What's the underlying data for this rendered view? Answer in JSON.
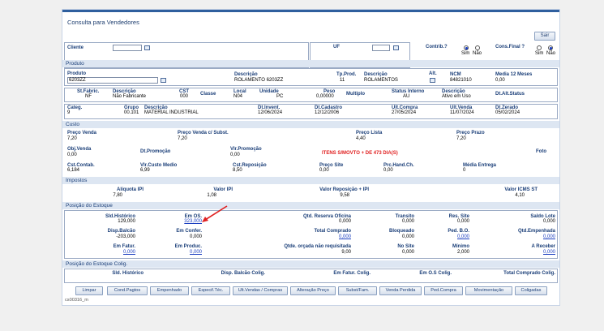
{
  "window": {
    "title": "Consulta para Vendedores",
    "footer_code": "cs00316_m"
  },
  "toolbar": {
    "sair_label": "Sair"
  },
  "filters": {
    "cliente_label": "Cliente",
    "cliente_value": "",
    "uf_label": "UF",
    "uf_value": "",
    "contrib_label": "Contrib.?",
    "final_label": "Cons.Final ?",
    "sim_label": "Sim",
    "nao_label": "Não"
  },
  "sections": {
    "produto": "Produto",
    "custo": "Custo",
    "impostos": "Impostos",
    "estoque": "Posição do Estoque",
    "estoque_colig": "Posição do Estoque Colig."
  },
  "produto": {
    "produto_label": "Produto",
    "produto_value": "6203ZZ",
    "descricao_label": "Descrição",
    "descricao_value": "ROLAMENTO 6203ZZ",
    "tpprod_label": "Tp.Prod.",
    "tpprod_value": "11",
    "desc2_label": "Descrição",
    "desc2_value": "ROLAMENTOS",
    "alt_label": "Alt.",
    "ncm_label": "NCM",
    "ncm_value": "84821010",
    "media_label": "Media 12 Meses",
    "media_value": "0,00",
    "stfabric_label": "St.Fabric.",
    "stfabric_value": "NF",
    "desc3_label": "Descrição",
    "desc3_value": "Não Fabricante",
    "cst_label": "CST",
    "cst_value": "000",
    "classe_label": "Classe",
    "local_label": "Local",
    "local_value": "N04",
    "unidade_label": "Unidade",
    "unidade_value": "PC",
    "peso_label": "Peso",
    "peso_value": "0,00000",
    "multiplo_label": "Multiplo",
    "status_label": "Status Interno",
    "status_value": "AU",
    "desc4_label": "Descrição",
    "desc4_value": "Ativo em Uso",
    "dtalt_label": "Dt.Alt.Status",
    "categ_label": "Categ.",
    "categ_value": "9",
    "grupo_label": "Grupo",
    "grupo_value": "00.101",
    "desc5_label": "Descrição",
    "desc5_value": "MATERIAL INDUSTRIAL",
    "dtinvent_label": "Dt.Invent.",
    "dtinvent_value": "12/06/2024",
    "dtcadastro_label": "Dt.Cadastro",
    "dtcadastro_value": "12/12/2006",
    "ultcompra_label": "Ult.Compra",
    "ultcompra_value": "27/05/2024",
    "ultvenda_label": "Ult.Venda",
    "ultvenda_value": "11/07/2024",
    "dtzerado_label": "Dt.Zerado",
    "dtzerado_value": "05/02/2024"
  },
  "custo": {
    "precovenda_label": "Preço Venda",
    "precovenda_value": "7,20",
    "precovendasubst_label": "Preço Venda c/ Subst.",
    "precovendasubst_value": "7,20",
    "precolista_label": "Preço Lista",
    "precolista_value": "4,40",
    "precoprazo_label": "Preço Prazo",
    "precoprazo_value": "7,20",
    "objvenda_label": "Obj.Venda",
    "objvenda_value": "0,00",
    "dtpromocao_label": "Dt.Promoção",
    "vlrpromocao_label": "Vlr.Promoção",
    "vlrpromocao_value": "0,00",
    "alert": "ITENS S/MOVTO + DE 473 DIA(S)",
    "foto_label": "Foto",
    "cstcontab_label": "Cst.Contab.",
    "cstcontab_value": "6,184",
    "vlrcusto_label": "Vlr.Custo Medio",
    "vlrcusto_value": "6,99",
    "cstrepos_label": "Cst.Reposição",
    "cstrepos_value": "8,50",
    "precosite_label": "Preço Site",
    "precosite_value": "0,00",
    "prchand_label": "Prc.Hand.Ch.",
    "prchand_value": "0,00",
    "mediaentrega_label": "Média Entrega",
    "mediaentrega_value": "0"
  },
  "impostos": {
    "aliqipi_label": "Alíquota IPI",
    "aliqipi_value": "7,80",
    "valoripi_label": "Valor IPI",
    "valoripi_value": "1,08",
    "valorrepos_label": "Valor Reposição + IPI",
    "valorrepos_value": "9,58",
    "valoricms_label": "Valor ICMS ST",
    "valoricms_value": "4,10"
  },
  "estoque": {
    "sldhist_label": "Sld.Histórico",
    "sldhist_value": "129,000",
    "emos_label": "Em OS.",
    "emos_value": "323,000",
    "qtdreserva_label": "Qtd. Reserva Oficina",
    "qtdreserva_value": "0,000",
    "transito_label": "Transito",
    "transito_value": "0,000",
    "ressite_label": "Res. Site",
    "ressite_value": "0,000",
    "saldolote_label": "Saldo Lote",
    "saldolote_value": "0,000",
    "dispbalcao_label": "Disp.Balcão",
    "dispbalcao_value": "-203,000",
    "emconfer_label": "Em Confer.",
    "emconfer_value": "0,000",
    "totalcomprado_label": "Total Comprado",
    "totalcomprado_value": "0,000",
    "bloqueado_label": "Bloqueado",
    "bloqueado_value": "0,000",
    "pedbo_label": "Ped. B.O.",
    "pedbo_value": "0,000",
    "qtdempenhada_label": "Qtd.Empenhada",
    "qtdempenhada_value": "0,000",
    "emfatur_label": "Em Fatur.",
    "emfatur_value": "0,000",
    "emproduc_label": "Em Produc.",
    "emproduc_value": "0,000",
    "qtdeorcada_label": "Qtde. orçada não requisitada",
    "qtdeorcada_value": "9,00",
    "nosite_label": "No Site",
    "nosite_value": "0,000",
    "minimo_label": "Mínimo",
    "minimo_value": "2,000",
    "areceber_label": "A Receber",
    "areceber_value": "0,000"
  },
  "estoque_colig": {
    "sldhist_label": "Sld. Histórico",
    "dispbalcao_label": "Disp. Balcão Colig.",
    "emfatur_label": "Em Fatur. Colig.",
    "emos_label": "Em O.S Colig.",
    "totalcomprado_label": "Total Comprado Colig."
  },
  "buttons": [
    "Limpar",
    "Cond.Pagtos",
    "Empenhado",
    "Especif.Téc.",
    "Ult.Vendas / Compras",
    "Alteração Preço",
    "Subst/Fam.",
    "Venda Perdida",
    "Ped.Compra",
    "Movimentação",
    "Coligadas"
  ],
  "colors": {
    "accent": "#1a3e78",
    "link": "#1a3ec0",
    "alert": "#e02020",
    "section_bg": "#dde6f2"
  }
}
